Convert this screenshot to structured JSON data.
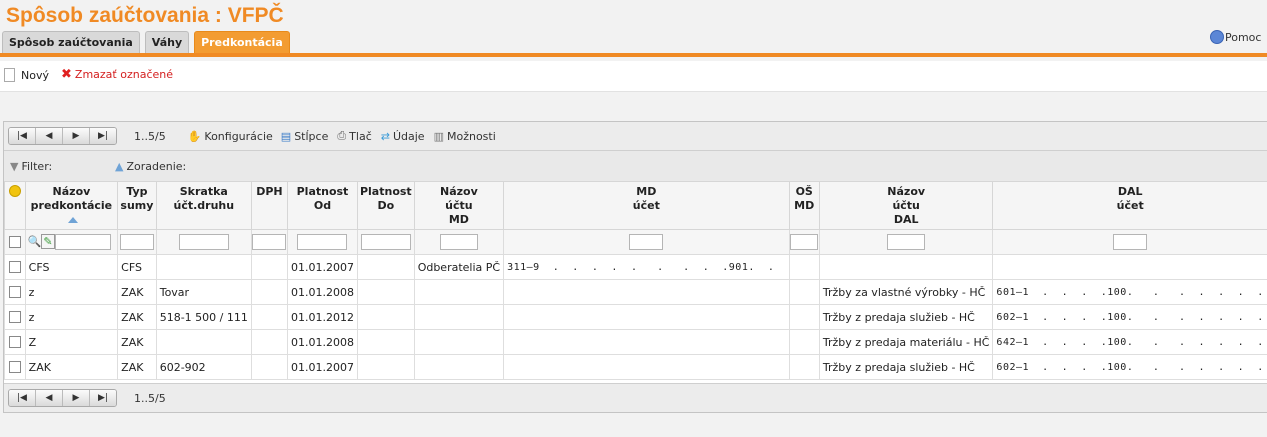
{
  "page": {
    "title": "Spôsob zaúčtovania :  VFPČ"
  },
  "tabs": [
    {
      "label": "Spôsob zaúčtovania"
    },
    {
      "label": "Váhy"
    },
    {
      "label": "Predkontácia"
    }
  ],
  "help": {
    "label": "Pomoc"
  },
  "toolbar": {
    "new_label": "Nový",
    "delete_label": "Zmazať označené"
  },
  "pager": {
    "range": "1..5/5",
    "buttons": [
      "|◀",
      "◀",
      "▶",
      "▶|"
    ]
  },
  "grid_tools": {
    "config": "Konfigurácie",
    "columns": "Stĺpce",
    "print": "Tlač",
    "data": "Údaje",
    "options": "Možnosti"
  },
  "filterbar": {
    "filter_label": "Filter:",
    "sort_label": "Zoradenie:"
  },
  "columns": [
    {
      "label": "Názov\npredkontácie"
    },
    {
      "label": "Typ\nsumy"
    },
    {
      "label": "Skratka\núčt.druhu"
    },
    {
      "label": "DPH"
    },
    {
      "label": "Platnost\nOd"
    },
    {
      "label": "Platnost\nDo"
    },
    {
      "label": "Názov\núčtu\nMD"
    },
    {
      "label": "MD\núčet"
    },
    {
      "label": "OŠ\nMD"
    },
    {
      "label": "Názov\núčtu\nDAL"
    },
    {
      "label": "DAL\núčet"
    }
  ],
  "rows": [
    {
      "cells": [
        "CFS",
        "CFS",
        "",
        "",
        "01.01.2007",
        "",
        "Odberatelia PČ",
        "311–9  .  .  .  .  .   .   .  .  .901.  .",
        "",
        "",
        ""
      ]
    },
    {
      "cells": [
        "z",
        "ZAK",
        "Tovar",
        "",
        "01.01.2008",
        "",
        "",
        "",
        "",
        "Tržby za vlastné výrobky - HČ",
        "601–1  .  .  .  .100.   .   .  .  .  .  ."
      ]
    },
    {
      "cells": [
        "z",
        "ZAK",
        "518-1 500 / 111",
        "",
        "01.01.2012",
        "",
        "",
        "",
        "",
        "Tržby z predaja služieb - HČ",
        "602–1  .  .  .  .100.   .   .  .  .  .  ."
      ]
    },
    {
      "cells": [
        "Z",
        "ZAK",
        "",
        "",
        "01.01.2008",
        "",
        "",
        "",
        "",
        "Tržby z predaja materiálu - HČ",
        "642–1  .  .  .  .100.   .   .  .  .  .  ."
      ]
    },
    {
      "cells": [
        "ZAK",
        "ZAK",
        "602-902",
        "",
        "01.01.2007",
        "",
        "",
        "",
        "",
        "Tržby z predaja služieb - HČ",
        "602–1  .  .  .  .100.   .   .  .  .  .  ."
      ]
    }
  ],
  "colors": {
    "accent": "#f08a24",
    "tab_active": "#f39c32",
    "delete_red": "#e02020"
  },
  "icons": [
    "help-icon",
    "new-doc-icon",
    "delete-x-icon",
    "configure-icon",
    "columns-icon",
    "print-icon",
    "data-icon",
    "options-icon",
    "filter-funnel-icon",
    "sort-icon",
    "search-icon",
    "clear-filter-icon"
  ]
}
